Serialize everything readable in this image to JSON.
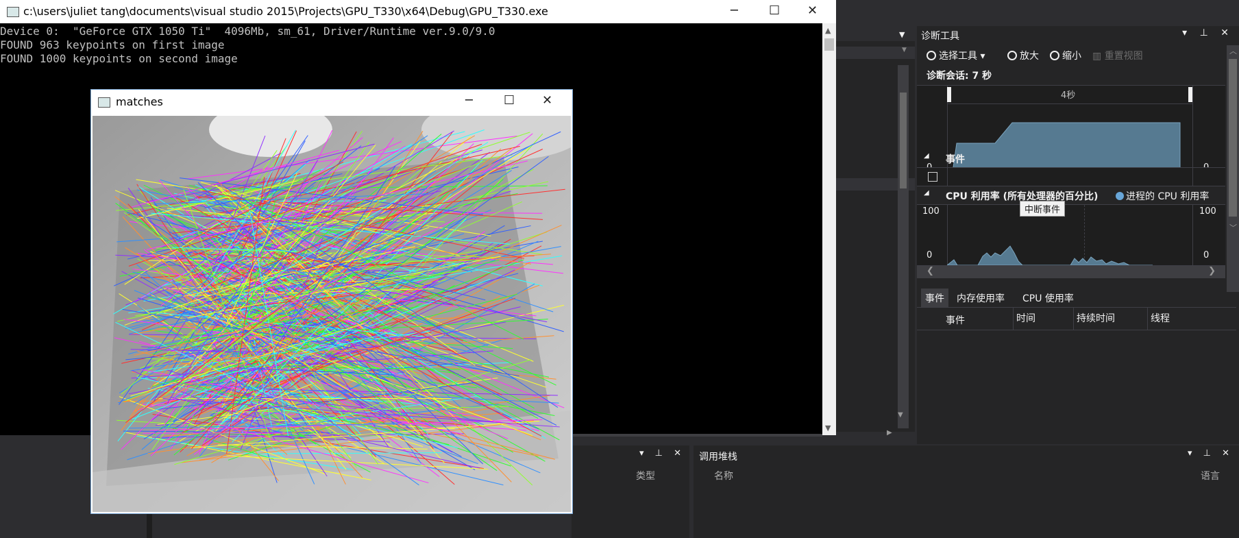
{
  "console": {
    "title": "c:\\users\\juliet tang\\documents\\visual studio 2015\\Projects\\GPU_T330\\x64\\Debug\\GPU_T330.exe",
    "lines": [
      "Device 0:  \"GeForce GTX 1050 Ti\"  4096Mb, sm_61, Driver/Runtime ver.9.0/9.0",
      "FOUND 963 keypoints on first image",
      "FOUND 1000 keypoints on second image"
    ]
  },
  "matches_window": {
    "title": "matches"
  },
  "diagnostics": {
    "title": "诊断工具",
    "toolbar": {
      "select_tools": "选择工具",
      "zoom_in": "放大",
      "zoom_out": "缩小",
      "reset_view": "重置视图"
    },
    "session": "诊断会话: 7 秒",
    "timeline_label": "4秒",
    "events_title": "事件",
    "cpu_title": "CPU 利用率 (所有处理器的百分比)",
    "cpu_legend": "进程的 CPU 利用率",
    "tooltip": "中断事件",
    "axis": {
      "zero": "0",
      "hundred": "100"
    },
    "tabs": [
      "事件",
      "内存使用率",
      "CPU 使用率"
    ],
    "columns": [
      "事件",
      "时间",
      "持续时间",
      "线程"
    ]
  },
  "bottom_left_panel": {
    "column_type": "类型"
  },
  "call_stack": {
    "title": "调用堆栈",
    "columns": {
      "name": "名称",
      "language": "语言"
    }
  },
  "colors": {
    "vs_bg": "#2d2d30",
    "panel_bg": "#252526",
    "graph_fill": "#567a91",
    "accent": "#68a6d8"
  }
}
